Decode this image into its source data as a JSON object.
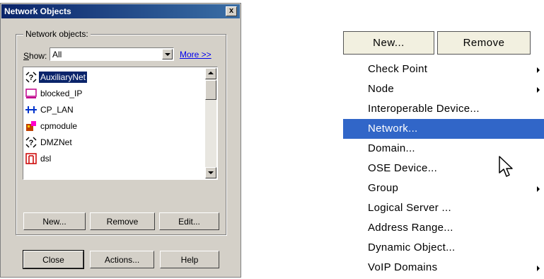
{
  "dialog": {
    "title": "Network Objects",
    "close_glyph": "x",
    "group_label": "Network objects:",
    "show_label_first": "S",
    "show_label_rest": "how:",
    "show_value": "All",
    "more_link": "More >>",
    "items": [
      {
        "label": "AuxiliaryNet",
        "icon": "network-question-icon",
        "selected": true
      },
      {
        "label": "blocked_IP",
        "icon": "host-icon",
        "selected": false
      },
      {
        "label": "CP_LAN",
        "icon": "network-icon",
        "selected": false
      },
      {
        "label": "cpmodule",
        "icon": "gateway-icon",
        "selected": false
      },
      {
        "label": "DMZNet",
        "icon": "network-question-icon",
        "selected": false
      },
      {
        "label": "dsl",
        "icon": "firewall-icon",
        "selected": false
      }
    ],
    "buttons": {
      "new": "New...",
      "remove": "Remove",
      "edit": "Edit...",
      "close": "Close",
      "actions": "Actions...",
      "help": "Help"
    }
  },
  "menu": {
    "new_button": "New...",
    "remove_button": "Remove",
    "items": [
      {
        "label": "Check Point",
        "submenu": true
      },
      {
        "label": "Node",
        "submenu": true
      },
      {
        "label": "Interoperable Device...",
        "submenu": false
      },
      {
        "label": "Network...",
        "submenu": false,
        "highlighted": true
      },
      {
        "label": "Domain...",
        "submenu": false
      },
      {
        "label": "OSE Device...",
        "submenu": false
      },
      {
        "label": "Group",
        "submenu": true
      },
      {
        "label": "Logical Server ...",
        "submenu": false
      },
      {
        "label": "Address Range...",
        "submenu": false
      },
      {
        "label": "Dynamic Object...",
        "submenu": false
      },
      {
        "label": "VoIP Domains",
        "submenu": true
      }
    ],
    "highlight_color": "#3166c8"
  }
}
